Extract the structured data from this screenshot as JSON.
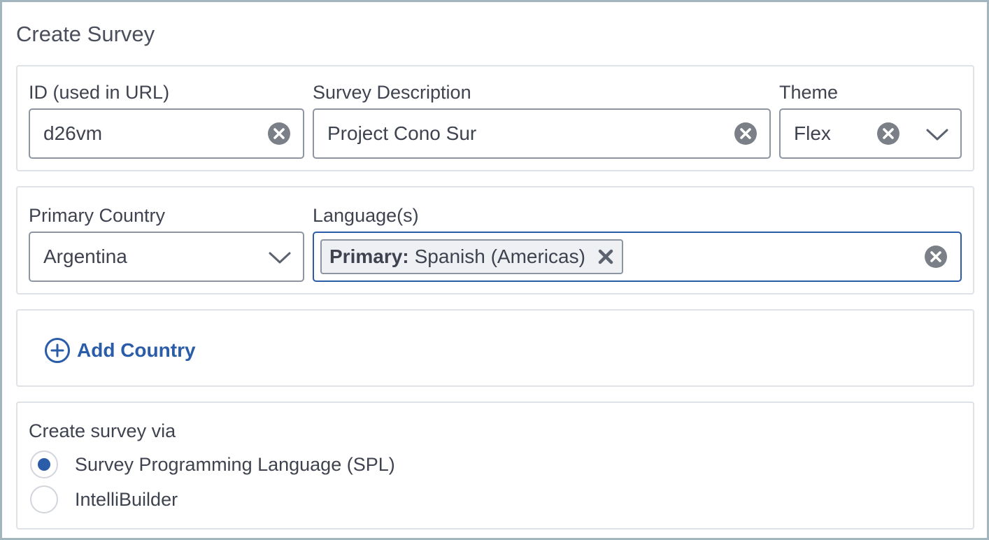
{
  "form": {
    "title": "Create Survey"
  },
  "basics": {
    "id": {
      "label": "ID (used in URL)",
      "value": "d26vm"
    },
    "description": {
      "label": "Survey Description",
      "value": "Project Cono Sur"
    },
    "theme": {
      "label": "Theme",
      "value": "Flex"
    }
  },
  "locale": {
    "country": {
      "label": "Primary Country",
      "value": "Argentina"
    },
    "languages": {
      "label": "Language(s)",
      "tags": [
        {
          "prefix": "Primary:",
          "value": "Spanish (Americas)"
        }
      ]
    }
  },
  "add_country": {
    "label": "Add Country"
  },
  "create_via": {
    "label": "Create survey via",
    "options": [
      {
        "label": "Survey Programming Language (SPL)",
        "selected": true
      },
      {
        "label": "IntelliBuilder",
        "selected": false
      }
    ]
  },
  "colors": {
    "accent": "#2a5ca8",
    "border": "#8d95a2",
    "text": "#3f4350",
    "panel_border": "#dfe2e6",
    "frame_border": "#a3b5bf"
  },
  "icons": {
    "clear": "circle-x-icon",
    "dropdown": "chevron-down-icon",
    "remove_tag": "x-icon",
    "add": "plus-circle-icon"
  }
}
